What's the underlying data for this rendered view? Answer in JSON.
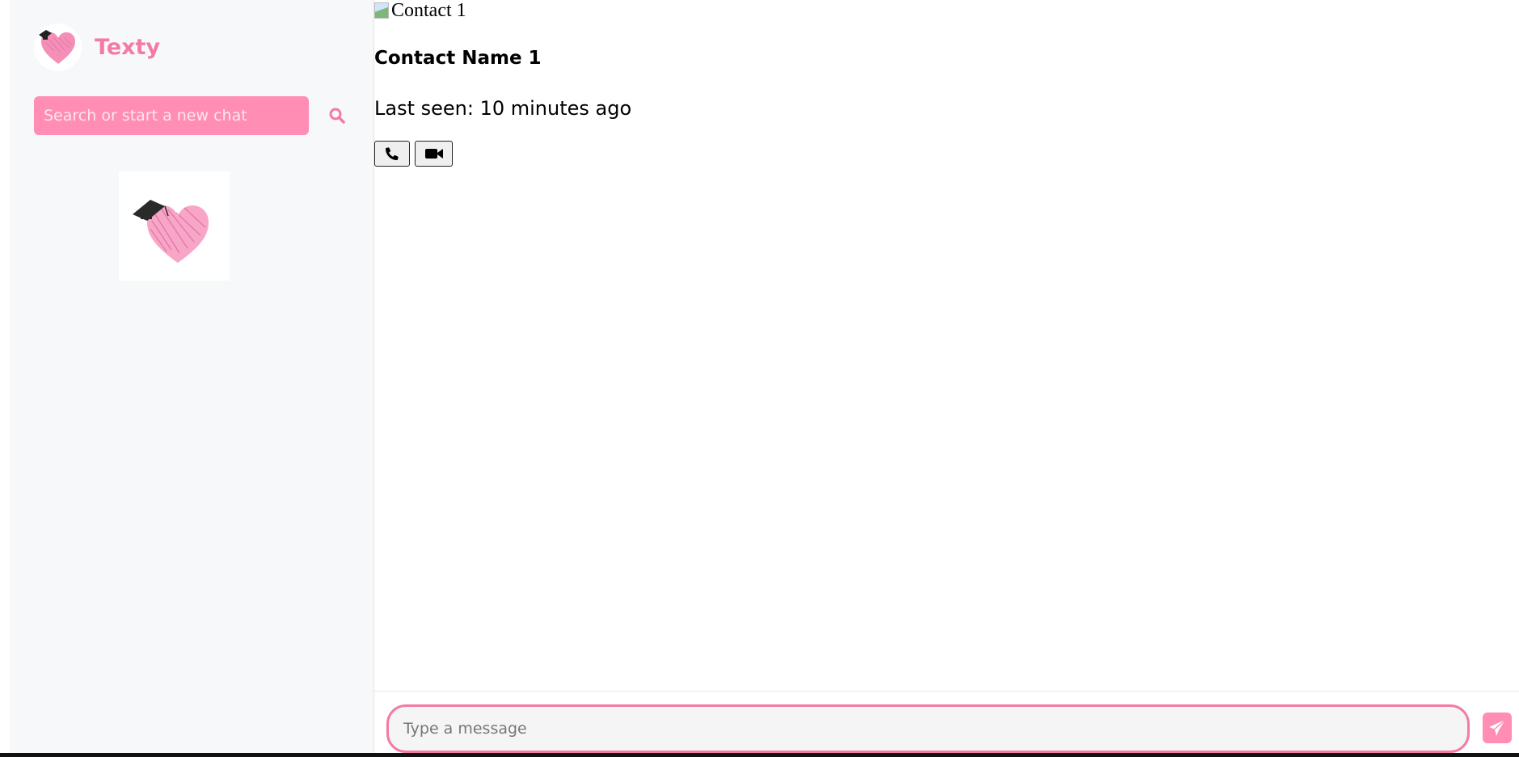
{
  "app": {
    "name": "Texty"
  },
  "sidebar": {
    "logo_icon": "heart-graduation-cap-icon",
    "search": {
      "placeholder": "Search or start a new chat",
      "value": ""
    },
    "search_icon": "search-icon"
  },
  "chat": {
    "contact_image_alt": "Contact 1",
    "contact_name": "Contact Name 1",
    "last_seen": "Last seen: 10 minutes ago",
    "call_icon": "phone-icon",
    "video_icon": "video-camera-icon"
  },
  "composer": {
    "placeholder": "Type a message",
    "value": "",
    "send_icon": "paper-plane-icon"
  },
  "colors": {
    "accent": "#f47aa6",
    "accent_light": "#ff8db4",
    "sidebar_bg": "#f7f8fa"
  }
}
